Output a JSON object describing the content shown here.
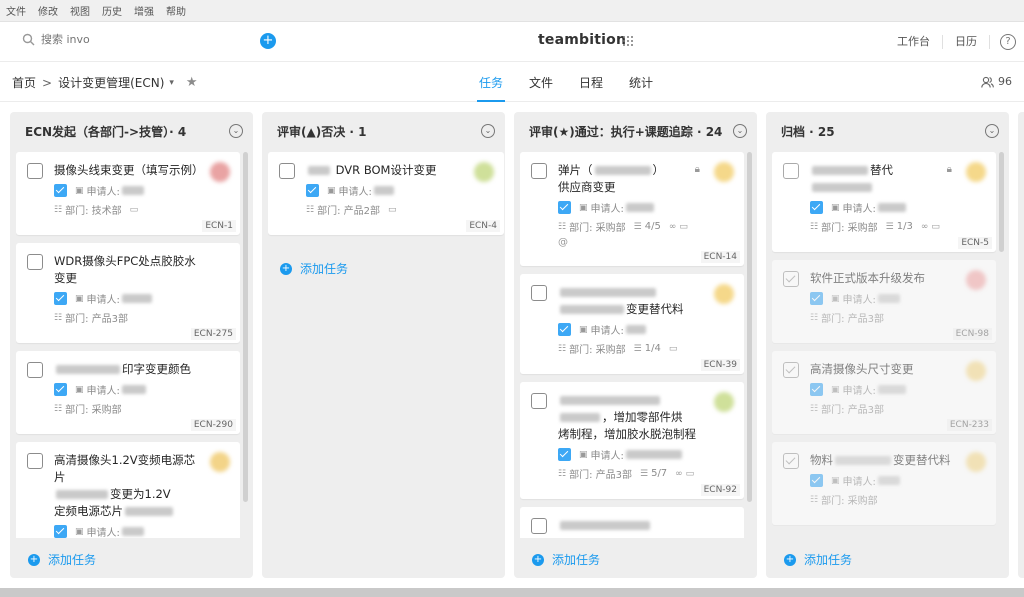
{
  "menubar": [
    "文件",
    "修改",
    "视图",
    "历史",
    "增强",
    "帮助"
  ],
  "header": {
    "search_placeholder": "搜索 invo",
    "logo": "teambition",
    "workbench": "工作台",
    "calendar": "日历",
    "help": "?"
  },
  "subheader": {
    "home": "首页",
    "sep": ">",
    "project": "设计变更管理(ECN)",
    "tabs": [
      "任务",
      "文件",
      "日程",
      "统计"
    ],
    "member_count": "96"
  },
  "accent": "#1b9aee",
  "columns": [
    {
      "title": "ECN发起（各部门->技管）· 4",
      "add_task": "添加任务",
      "cards": [
        {
          "title": "摄像头线束变更（填写示例）",
          "applicant": "申请人:",
          "dept": "部门: 技术部",
          "id": "ECN-1",
          "avatar": "#e9a3a3"
        },
        {
          "title": "WDR摄像头FPC处点胶胶水变更",
          "applicant": "申请人:",
          "dept": "部门: 产品3部",
          "id": "ECN-275"
        },
        {
          "title": "印字变更颜色",
          "applicant": "申请人:",
          "dept": "部门: 采购部",
          "id": "ECN-290"
        },
        {
          "title": "高清摄像头1.2V变频电源芯片",
          "title2": "变更为1.2V",
          "title3": "定频电源芯片",
          "applicant": "申请人:",
          "id": "",
          "avatar": "#f3d488"
        }
      ]
    },
    {
      "title": "评审(▲)否决 · 1",
      "add_task": "添加任务",
      "cards": [
        {
          "title": "DVR BOM设计变更",
          "applicant": "申请人:",
          "dept": "部门: 产品2部",
          "id": "ECN-4",
          "avatar": "#cfe09a"
        }
      ]
    },
    {
      "title": "评审(★)通过：执行+课题追踪 · 24",
      "add_task": "添加任务",
      "cards": [
        {
          "title": "弹片（",
          "title2": "供应商变更",
          "applicant": "申请人:",
          "dept": "部门: 采购部",
          "sub": "4/5",
          "id": "ECN-14",
          "avatar": "#f5d88a"
        },
        {
          "title": "变更替代料",
          "applicant": "申请人:",
          "dept": "部门: 采购部",
          "sub": "1/4",
          "id": "ECN-39",
          "avatar": "#f5d88a"
        },
        {
          "title": "，增加零部件烘",
          "title2": "烤制程，增加胶水脱泡制程",
          "applicant": "申请人:",
          "dept": "部门: 产品3部",
          "sub": "5/7",
          "id": "ECN-92",
          "avatar": "#cfe09a"
        }
      ]
    },
    {
      "title": "归档 · 25",
      "add_task": "添加任务",
      "cards": [
        {
          "title": "替代",
          "applicant": "申请人:",
          "dept": "部门: 采购部",
          "sub": "1/3",
          "id": "ECN-5",
          "avatar": "#f5d88a"
        },
        {
          "title": "软件正式版本升级发布",
          "applicant": "申请人:",
          "dept": "部门: 产品3部",
          "id": "ECN-98",
          "avatar": "#f2a7a7"
        },
        {
          "title": "高清摄像头尺寸变更",
          "applicant": "申请人:",
          "dept": "部门: 产品3部",
          "id": "ECN-233",
          "avatar": "#f5d88a"
        },
        {
          "title": "物料",
          "title2": "变更替代料",
          "applicant": "申请人:",
          "dept": "部门: 采购部",
          "id": "",
          "avatar": "#f5d88a"
        }
      ]
    }
  ]
}
